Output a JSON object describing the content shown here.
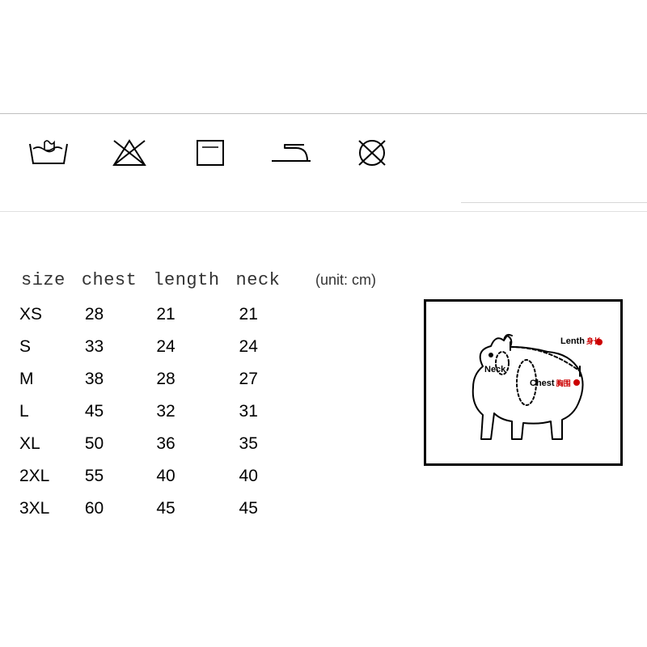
{
  "chart_data": {
    "type": "table",
    "title": "",
    "unit_label": "(unit: cm)",
    "columns": [
      "size",
      "chest",
      "length",
      "neck"
    ],
    "rows": [
      {
        "size": "XS",
        "chest": 28,
        "length": 21,
        "neck": 21
      },
      {
        "size": "S",
        "chest": 33,
        "length": 24,
        "neck": 24
      },
      {
        "size": "M",
        "chest": 38,
        "length": 28,
        "neck": 27
      },
      {
        "size": "L",
        "chest": 45,
        "length": 32,
        "neck": 31
      },
      {
        "size": "XL",
        "chest": 50,
        "length": 36,
        "neck": 35
      },
      {
        "size": "2XL",
        "chest": 55,
        "length": 40,
        "neck": 40
      },
      {
        "size": "3XL",
        "chest": 60,
        "length": 45,
        "neck": 45
      }
    ]
  },
  "care_icons": [
    {
      "name": "hand-wash-icon"
    },
    {
      "name": "no-bleach-icon"
    },
    {
      "name": "tumble-dry-icon"
    },
    {
      "name": "iron-icon"
    },
    {
      "name": "no-dryclean-icon"
    }
  ],
  "diagram_labels": {
    "length": {
      "text": "Lenth",
      "cn": "身长"
    },
    "neck": {
      "text": "Neck",
      "cn": ""
    },
    "chest": {
      "text": "Chest",
      "cn": "胸围"
    }
  }
}
